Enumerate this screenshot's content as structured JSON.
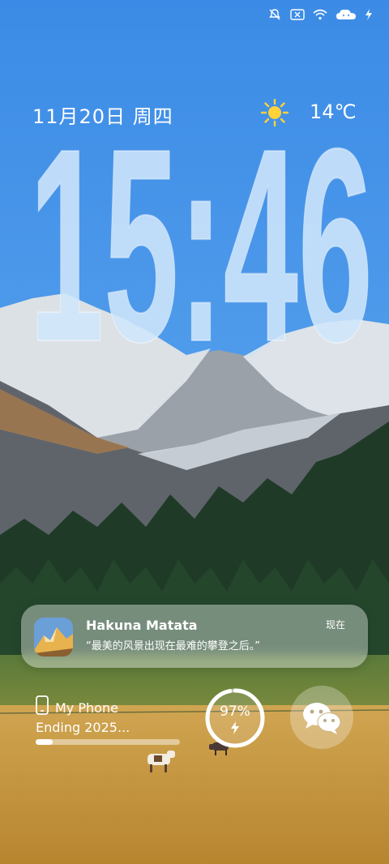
{
  "status_bar": {
    "icons": [
      "bell-off-icon",
      "sim-x-icon",
      "wifi-icon",
      "cloud-battery-icon",
      "charging-bolt-icon"
    ]
  },
  "lockscreen": {
    "date": "11月20日 周四",
    "weather_icon": "sun-icon",
    "temperature": "14℃",
    "time": "15:46"
  },
  "notification": {
    "app_icon": "mountain-thumbnail-icon",
    "title": "Hakuna Matata",
    "time": "现在",
    "body": "“最美的风景出现在最难的攀登之后。”"
  },
  "widgets": {
    "device": {
      "icon": "phone-icon",
      "name": "My Phone",
      "subtitle": "Ending 2025...",
      "progress": 0.12
    },
    "battery": {
      "percent": "97%",
      "level": 0.97,
      "icon": "charging-bolt-icon"
    },
    "shortcut": {
      "icon": "wechat-icon"
    }
  },
  "colors": {
    "sky_top": "#3f8ee8",
    "sky_bottom": "#5aa7ef",
    "grass": "#c99b3f",
    "forest": "#1e3a24",
    "text": "#ffffff"
  }
}
